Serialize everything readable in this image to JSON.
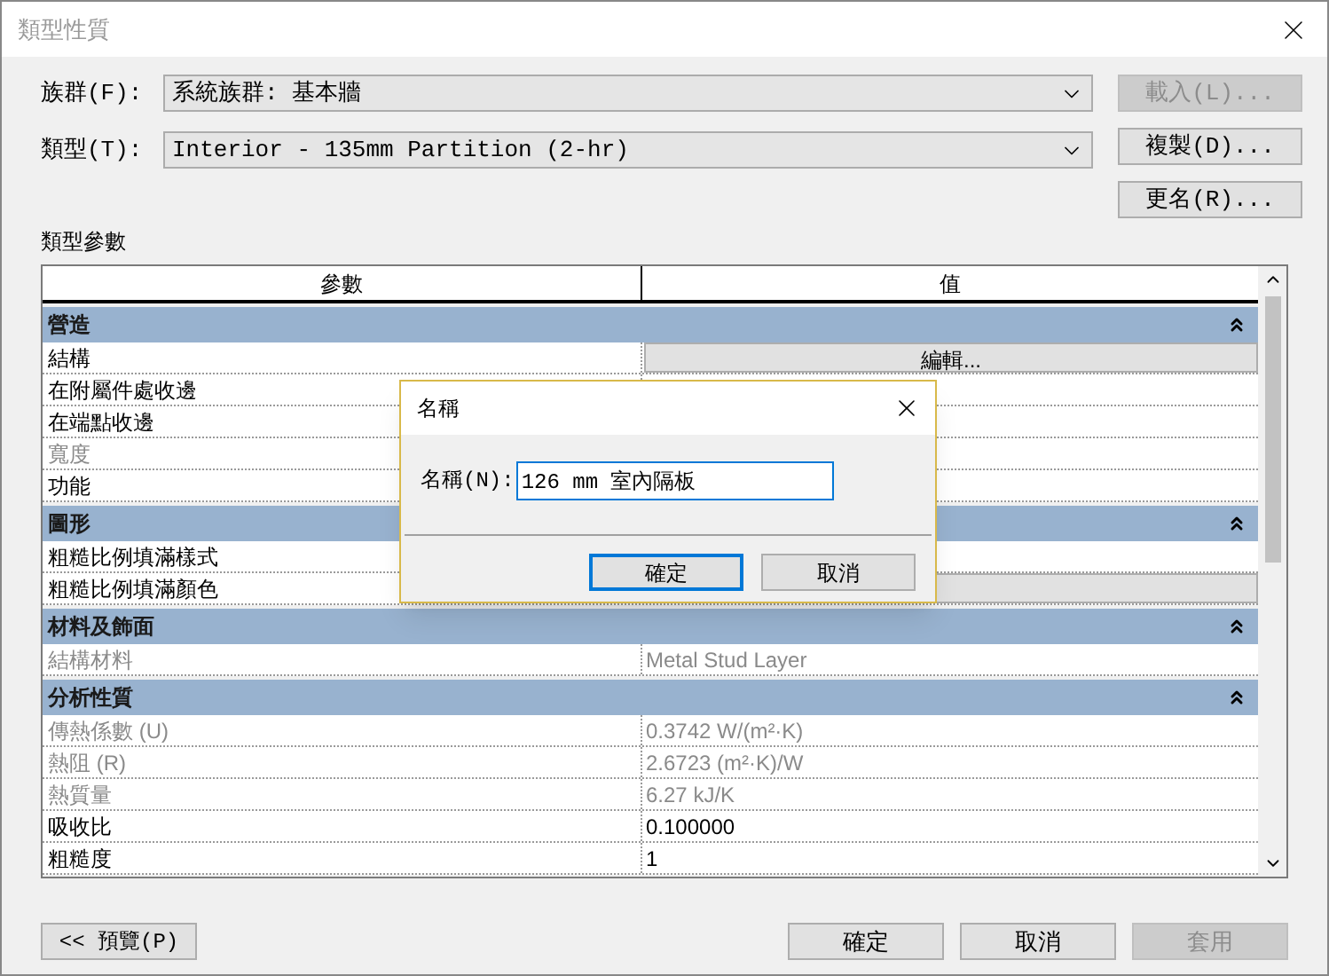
{
  "window": {
    "title": "類型性質"
  },
  "family": {
    "label": "族群(F):",
    "value": "系統族群: 基本牆"
  },
  "type": {
    "label": "類型(T):",
    "value": "Interior - 135mm Partition (2-hr)"
  },
  "side_buttons": [
    {
      "label": "載入(L)...",
      "disabled": true
    },
    {
      "label": "複製(D)...",
      "disabled": false
    },
    {
      "label": "更名(R)...",
      "disabled": false
    }
  ],
  "params_label": "類型參數",
  "table": {
    "columns": [
      "參數",
      "值"
    ],
    "rows": [
      {
        "kind": "section",
        "label": "營造",
        "expanded": true
      },
      {
        "kind": "row",
        "label": "結構",
        "disabled": false,
        "value": "編輯...",
        "button": true
      },
      {
        "kind": "row",
        "label": "在附屬件處收邊",
        "disabled": false
      },
      {
        "kind": "row",
        "label": "在端點收邊",
        "disabled": false
      },
      {
        "kind": "row",
        "label": "寬度",
        "disabled": true
      },
      {
        "kind": "row",
        "label": "功能",
        "disabled": false
      },
      {
        "kind": "section",
        "label": "圖形",
        "expanded": true
      },
      {
        "kind": "row",
        "label": "粗糙比例填滿樣式",
        "disabled": false
      },
      {
        "kind": "row",
        "label": "粗糙比例填滿顏色",
        "disabled": false,
        "button": true
      },
      {
        "kind": "section",
        "label": "材料及飾面",
        "expanded": true
      },
      {
        "kind": "row",
        "label": "結構材料",
        "disabled": true,
        "value": "Metal Stud Layer"
      },
      {
        "kind": "section",
        "label": "分析性質",
        "expanded": true
      },
      {
        "kind": "row",
        "label": "傳熱係數 (U)",
        "disabled": true,
        "value": "0.3742 W/(m²·K)"
      },
      {
        "kind": "row",
        "label": "熱阻 (R)",
        "disabled": true,
        "value": "2.6723 (m²·K)/W"
      },
      {
        "kind": "row",
        "label": "熱質量",
        "disabled": true,
        "value": "6.27 kJ/K"
      },
      {
        "kind": "row",
        "label": "吸收比",
        "disabled": false,
        "value": "0.100000"
      },
      {
        "kind": "row",
        "label": "粗糙度",
        "disabled": false,
        "value": "1"
      }
    ]
  },
  "preview_button": "<< 預覽(P)",
  "bottom_buttons": [
    {
      "label": "確定",
      "disabled": false
    },
    {
      "label": "取消",
      "disabled": false
    },
    {
      "label": "套用",
      "disabled": true
    }
  ],
  "dialog": {
    "title": "名稱",
    "field_label": "名稱(N):",
    "value": "126 mm 室內隔板",
    "buttons": [
      {
        "label": "確定",
        "selected": true
      },
      {
        "label": "取消",
        "selected": false
      }
    ]
  }
}
